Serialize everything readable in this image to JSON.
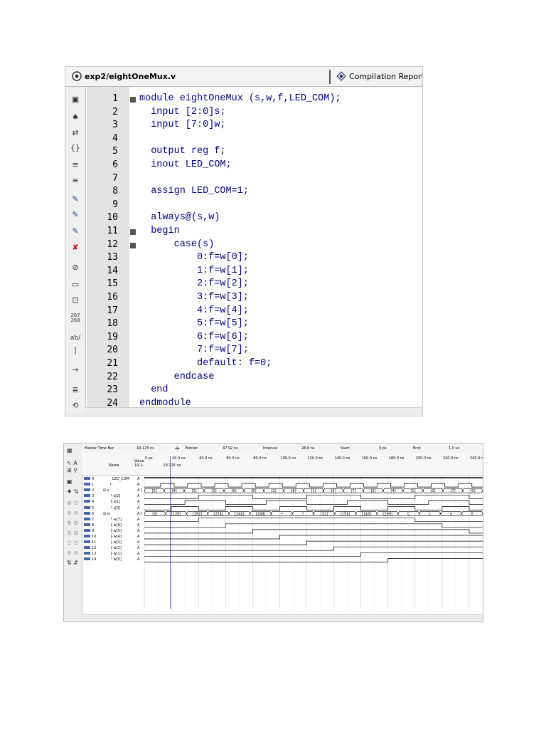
{
  "editor": {
    "file_tab": "exp2/eightOneMux.v",
    "report_tab": "Compilation Report - Fl",
    "lines": [
      {
        "n": "1",
        "text": "module eightOneMux (s,w,f,LED_COM);",
        "fold": true
      },
      {
        "n": "2",
        "text": "  input [2:0]s;",
        "fold": false
      },
      {
        "n": "3",
        "text": "  input [7:0]w;",
        "fold": false
      },
      {
        "n": "4",
        "text": "",
        "fold": false
      },
      {
        "n": "5",
        "text": "  output reg f;",
        "fold": false
      },
      {
        "n": "6",
        "text": "  inout LED_COM;",
        "fold": false
      },
      {
        "n": "7",
        "text": "",
        "fold": false
      },
      {
        "n": "8",
        "text": "  assign LED_COM=1;",
        "fold": false
      },
      {
        "n": "9",
        "text": "",
        "fold": false
      },
      {
        "n": "10",
        "text": "  always@(s,w)",
        "fold": false
      },
      {
        "n": "11",
        "text": "  begin",
        "fold": true
      },
      {
        "n": "12",
        "text": "      case(s)",
        "fold": true
      },
      {
        "n": "13",
        "text": "          0:f=w[0];",
        "fold": false
      },
      {
        "n": "14",
        "text": "          1:f=w[1];",
        "fold": false
      },
      {
        "n": "15",
        "text": "          2:f=w[2];",
        "fold": false
      },
      {
        "n": "16",
        "text": "          3:f=w[3];",
        "fold": false
      },
      {
        "n": "17",
        "text": "          4:f=w[4];",
        "fold": false
      },
      {
        "n": "18",
        "text": "          5:f=w[5];",
        "fold": false
      },
      {
        "n": "19",
        "text": "          6:f=w[6];",
        "fold": false
      },
      {
        "n": "20",
        "text": "          7:f=w[7];",
        "fold": false
      },
      {
        "n": "21",
        "text": "          default: f=0;",
        "fold": false
      },
      {
        "n": "22",
        "text": "      endcase",
        "fold": false
      },
      {
        "n": "23",
        "text": "  end",
        "fold": false
      },
      {
        "n": "24",
        "text": "endmodule",
        "fold": false
      }
    ],
    "toolbar_icons": [
      "page-icon",
      "binoculars-icon",
      "find-replace-icon",
      "braces-icon",
      "indent-icon",
      "unindent-icon",
      "blank-line",
      "bookmark-toggle-icon",
      "bookmark-next-icon",
      "bookmark-prev-icon",
      "bookmark-clear-icon",
      "paperclip-icon",
      "template-icon",
      "insert-file-icon",
      "line-number-icon",
      "spelling-icon",
      "cursor-bar-icon",
      "arrow-icon",
      "comment-icon",
      "uncomment-icon"
    ],
    "toolbar_text": {
      "line_numbers": "267\n268",
      "spell": "ab/"
    }
  },
  "waveform": {
    "master_time_bar_label": "Master Time Bar:",
    "master_time_bar_value": "19.125 ns",
    "pointer_label": "Pointer:",
    "pointer_value": "47.92 ns",
    "interval_label": "Interval:",
    "interval_value": "28.8 ns",
    "start_label": "Start:",
    "start_value": "0 ps",
    "end_label": "End:",
    "end_value": "1.0 us",
    "name_header": "Name",
    "value_header": "Value\n19.1:",
    "time_ticks": [
      "0 ps",
      "20.0 ns",
      "40.0 ns",
      "60.0 ns",
      "80.0 ns",
      "100.0 ns",
      "120.0 ns",
      "140.0 ns",
      "160.0 ns",
      "180.0 ns",
      "200.0 ns",
      "220.0 ns",
      "240.0 ns"
    ],
    "cursor_label": "19.125 ns",
    "signals": [
      {
        "id": "0",
        "name": "LED_COM",
        "value": "A"
      },
      {
        "id": "1",
        "name": "f",
        "value": "A"
      },
      {
        "id": "2",
        "name": "⊟ s",
        "value": "A ["
      },
      {
        "id": "3",
        "name": "└ s[2]",
        "value": "A"
      },
      {
        "id": "4",
        "name": "├ s[1]",
        "value": "A"
      },
      {
        "id": "5",
        "name": "└ s[0]",
        "value": "A"
      },
      {
        "id": "6",
        "name": "⊟ w",
        "value": "A ["
      },
      {
        "id": "7",
        "name": "└ w[7]",
        "value": "A"
      },
      {
        "id": "8",
        "name": "├ w[6]",
        "value": "A"
      },
      {
        "id": "9",
        "name": "├ w[5]",
        "value": "A"
      },
      {
        "id": "10",
        "name": "├ w[4]",
        "value": "A"
      },
      {
        "id": "11",
        "name": "├ w[3]",
        "value": "A"
      },
      {
        "id": "12",
        "name": "├ w[2]",
        "value": "A"
      },
      {
        "id": "13",
        "name": "├ w[1]",
        "value": "A"
      },
      {
        "id": "14",
        "name": "└ w[0]",
        "value": "A"
      }
    ],
    "bus_s_labels": [
      "[0]",
      "[4]",
      "[5]",
      "[3]",
      "[6]",
      "[0]",
      "[2]",
      "[6]",
      "[1]",
      "[5]",
      "[7]",
      "[2]",
      "[4]",
      "[1]",
      "[3]",
      "[7]",
      "[0]"
    ],
    "bus_w_labels": [
      "[0]",
      "[128]",
      "[192]",
      "[224]",
      "[240]",
      "[248]",
      "~",
      "?",
      "[31]",
      "[159]",
      "[143]",
      "[199]",
      "C",
      "c",
      "e",
      "0"
    ]
  }
}
